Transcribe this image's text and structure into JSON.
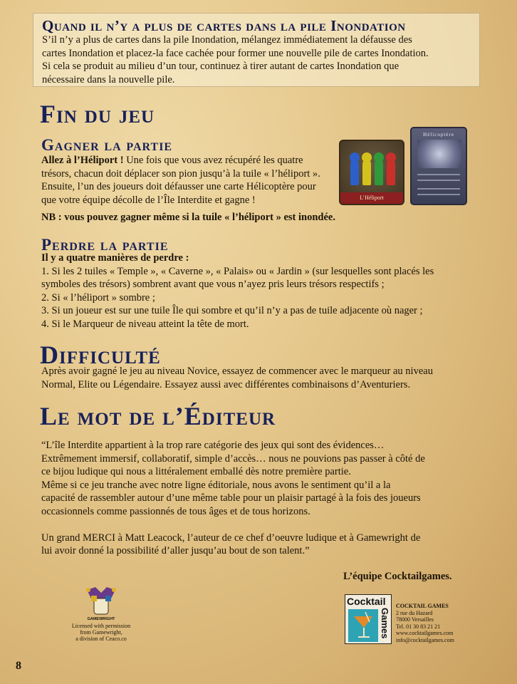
{
  "top_box": {
    "title": "Quand il n’y a plus de cartes dans la pile Inondation",
    "line1": "S’il n’y a plus de cartes dans la pile Inondation, mélangez immédiatement la défausse des",
    "line2": "cartes Inondation et placez-la face cachée pour former une nouvelle pile de cartes Inondation.",
    "line3": "Si cela se produit au milieu d’un tour, continuez à tirer autant de cartes Inondation que",
    "line4": "nécessaire dans la nouvelle pile."
  },
  "fin": {
    "title": "Fin du jeu",
    "gagner": {
      "title": "Gagner la partie",
      "lead": "Allez à l’Héliport !",
      "line1": " Une fois que vous avez récupéré les quatre",
      "line2": "trésors, chacun doit déplacer son pion jusqu’à la tuile « l’héliport ».",
      "line3": "Ensuite, l’un des joueurs doit défausser une carte Hélicoptère pour",
      "line4": "que votre équipe décolle de l’Île Interdite et gagne !",
      "nb": "NB : vous pouvez gagner même si la tuile « l’héliport » est inondée."
    },
    "perdre": {
      "title": "Perdre la partie",
      "intro": "Il y a quatre manières de perdre :",
      "item1a": "1. Si les 2 tuiles « Temple », « Caverne », « Palais» ou « Jardin » (sur lesquelles sont placés les",
      "item1b": "symboles des trésors) sombrent avant que vous n’ayez pris leurs trésors respectifs ;",
      "item2": "2. Si « l’héliport » sombre ;",
      "item3": "3. Si un joueur est sur une tuile Île qui sombre et qu’il n’y a pas de tuile adjacente où nager ;",
      "item4": "4. Si le Marqueur de niveau atteint la tête de mort."
    }
  },
  "cards": {
    "heliport_label": "L’Héliport",
    "helicoptere_label": "Hélicoptère"
  },
  "difficulte": {
    "title": "Difficulté",
    "line1": "Après avoir gagné le jeu au niveau Novice, essayez de commencer avec le marqueur au niveau",
    "line2": "Normal, Elite ou Légendaire. Essayez aussi avec différentes combinaisons d’Aventuriers."
  },
  "editeur": {
    "title": "Le mot de l’Éditeur",
    "p1": "“L’île Interdite appartient à la trop rare catégorie des jeux qui sont des évidences…",
    "p2": "Extrêmement immersif, collaboratif, simple d’accès… nous ne pouvions pas passer à côté de",
    "p3": "ce bijou ludique qui nous a littéralement emballé dès notre première partie.",
    "p4": "Même si ce jeu tranche avec notre ligne éditoriale, nous avons le sentiment qu’il a la",
    "p5": "capacité de rassembler autour d’une même table pour un plaisir partagé à la fois des joueurs",
    "p6": "occasionnels comme passionnés de tous âges et de tous horizons.",
    "p7": "Un grand MERCI à Matt Leacock, l’auteur de ce chef d’oeuvre ludique et à Gamewright de",
    "p8": "lui avoir donné la possibilité d’aller jusqu’au bout de son talent.”",
    "signature": "L’équipe Cocktailgames."
  },
  "gamewright": {
    "logo_text": "GAMEWRIGHT",
    "cap1": "Licensed with permission",
    "cap2": "from Gamewright,",
    "cap3": "a division of Ceaco.co"
  },
  "cocktail": {
    "logo1": "Cocktail",
    "logo2": "Games",
    "name": "COCKTAIL GAMES",
    "addr1": "2 rue du Hazard",
    "addr2": "78000 Versailles",
    "tel": "Tel. 01 30 83 21 21",
    "web": "www.cocktailgames.com",
    "mail": "info@cocktailgames.com"
  },
  "page_number": "8"
}
